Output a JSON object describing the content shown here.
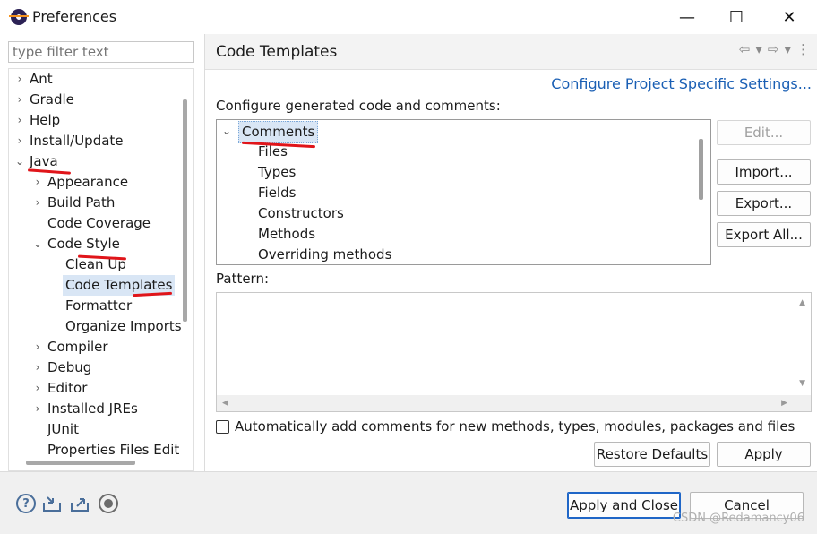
{
  "window": {
    "title": "Preferences",
    "minimize_glyph": "—",
    "maximize_glyph": "☐",
    "close_glyph": "✕"
  },
  "filter": {
    "placeholder": "type filter text"
  },
  "tree": [
    {
      "label": "Ant",
      "expanded": false,
      "level": 0
    },
    {
      "label": "Gradle",
      "expanded": false,
      "level": 0
    },
    {
      "label": "Help",
      "expanded": false,
      "level": 0
    },
    {
      "label": "Install/Update",
      "expanded": false,
      "level": 0
    },
    {
      "label": "Java",
      "expanded": true,
      "level": 0
    },
    {
      "label": "Appearance",
      "expanded": false,
      "level": 1
    },
    {
      "label": "Build Path",
      "expanded": false,
      "level": 1
    },
    {
      "label": "Code Coverage",
      "expanded": null,
      "level": 1
    },
    {
      "label": "Code Style",
      "expanded": true,
      "level": 1
    },
    {
      "label": "Clean Up",
      "expanded": null,
      "level": 2
    },
    {
      "label": "Code Templates",
      "expanded": null,
      "level": 2,
      "selected": true
    },
    {
      "label": "Formatter",
      "expanded": null,
      "level": 2
    },
    {
      "label": "Organize Imports",
      "expanded": null,
      "level": 2
    },
    {
      "label": "Compiler",
      "expanded": false,
      "level": 1
    },
    {
      "label": "Debug",
      "expanded": false,
      "level": 1
    },
    {
      "label": "Editor",
      "expanded": false,
      "level": 1
    },
    {
      "label": "Installed JREs",
      "expanded": false,
      "level": 1
    },
    {
      "label": "JUnit",
      "expanded": null,
      "level": 1
    },
    {
      "label": "Properties Files Edit",
      "expanded": null,
      "level": 1
    }
  ],
  "page": {
    "title": "Code Templates",
    "nav_back": "⇦",
    "nav_forward": "⇨",
    "nav_dropdown": "▾",
    "nav_menu": "⋮",
    "configure_link": "Configure Project Specific Settings...",
    "section_label": "Configure generated code and comments:",
    "templates": {
      "group": "Comments",
      "items": [
        "Files",
        "Types",
        "Fields",
        "Constructors",
        "Methods",
        "Overriding methods"
      ]
    },
    "buttons": {
      "edit": "Edit...",
      "import": "Import...",
      "export": "Export...",
      "export_all": "Export All..."
    },
    "pattern_label": "Pattern:",
    "auto_comments_label": "Automatically add comments for new methods, types, modules, packages and files",
    "restore_defaults": "Restore Defaults",
    "apply": "Apply"
  },
  "footer": {
    "help_glyph": "?",
    "apply_and_close": "Apply and Close",
    "cancel": "Cancel",
    "watermark": "CSDN @Redamancy06"
  },
  "colors": {
    "selection": "#d9e6f5",
    "link": "#1a5fb4",
    "annotation": "#e0151a"
  }
}
